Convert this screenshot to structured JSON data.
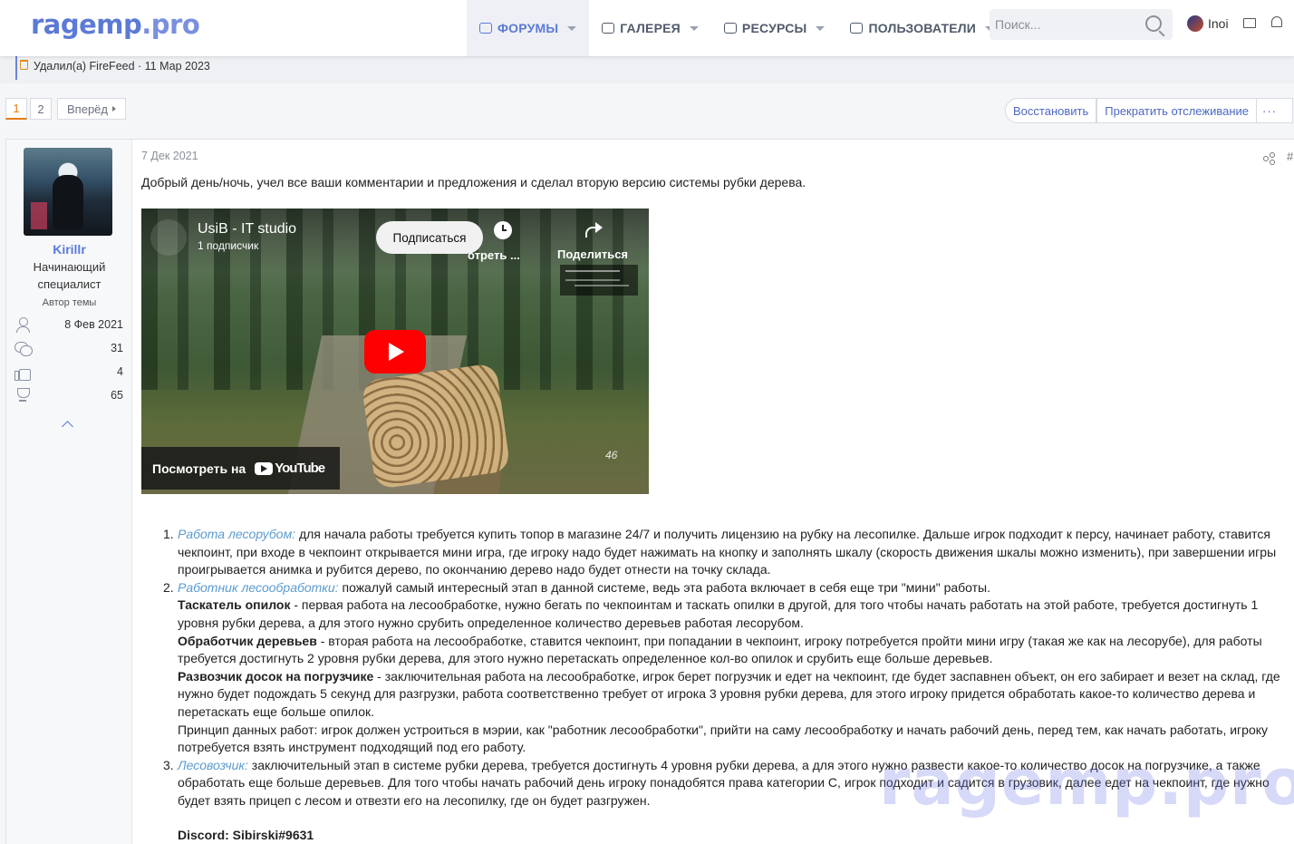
{
  "header": {
    "logo_text": "ragemp",
    "logo_dot": ".pro",
    "nav": [
      {
        "label": "ФОРУМЫ",
        "icon": "forum-icon",
        "active": true
      },
      {
        "label": "ГАЛЕРЕЯ",
        "icon": "gallery-icon"
      },
      {
        "label": "РЕСУРСЫ",
        "icon": "resources-icon"
      },
      {
        "label": "ПОЛЬЗОВАТЕЛИ",
        "icon": "users-icon"
      }
    ],
    "search_placeholder": "Поиск...",
    "username": "Inoi",
    "accent": "#5b7ad6"
  },
  "deleted_notice": "Удалил(а) FireFeed · 11 Мар 2023",
  "pagination": {
    "pages": [
      "1",
      "2"
    ],
    "current": "1",
    "next_label": "Вперёд"
  },
  "thread_actions": {
    "restore": "Восстановить",
    "unwatch": "Прекратить отслеживание",
    "more": "···"
  },
  "post": {
    "author": {
      "name": "Kirillr",
      "title": "Начинающий специалист",
      "badge": "Автор темы",
      "stats": [
        {
          "icon": "person-icon",
          "value": "8 Фев 2021"
        },
        {
          "icon": "chat-icon",
          "value": "31"
        },
        {
          "icon": "thumb-icon",
          "value": "4"
        },
        {
          "icon": "trophy-icon",
          "value": "65"
        }
      ]
    },
    "date": "7 Дек 2021",
    "hash": "#",
    "intro": "Добрый день/ночь, учел все ваши комментарии и предложения и сделал вторую версию системы рубки дерева.",
    "video": {
      "channel": "UsiB - IT studio",
      "subs": "1 подписчик",
      "subscribe": "Подписаться",
      "later": "отреть ...",
      "share": "Поделиться",
      "counter": "46",
      "watch_on": "Посмотреть на",
      "yt_word": "YouTube"
    },
    "list": [
      {
        "num": "1.",
        "title": "Работа лесорубом:",
        "text": " для начала работы требуется купить топор в магазине 24/7 и получить лицензию на рубку на лесопилке. Дальше игрок подходит к персу, начинает работу, ставится чекпоинт, при входе в чекпоинт открывается мини игра, где игроку надо будет нажимать на кнопку и заполнять шкалу (скорость движения шкалы можно изменить), при завершении игры проигрывается анимка и рубится дерево, по окончанию дерево надо будет отнести на точку склада."
      },
      {
        "num": "2.",
        "title": "Работник лесообработки:",
        "text": " пожалуй самый интересный этап в данной системе, ведь эта работа включает в себя еще три \"мини\" работы.",
        "subs": [
          {
            "b": "Таскатель опилок",
            "t": " - первая работа на лесообработке, нужно бегать по чекпоинтам и таскать опилки в другой, для того чтобы начать работать на этой работе, требуется достигнуть 1 уровня рубки дерева, а для этого нужно срубить определенное количество деревьев работая лесорубом."
          },
          {
            "b": "Обработчик деревьев",
            "t": " - вторая работа на лесообработке, ставится чекпоинт, при попадании в чекпоинт, игроку потребуется пройти мини игру (такая же как на лесорубе), для работы требуется достигнуть 2 уровня рубки дерева, для этого нужно перетаскать определенное кол-во опилок и срубить еще больше деревьев."
          },
          {
            "b": "Развозчик досок на погрузчике",
            "t": " - заключительная работа на лесообработке, игрок берет погрузчик и едет на чекпоинт, где будет заспавнен объект, он его забирает и везет на склад, где нужно будет подождать 5 секунд для разгрузки, работа соответственно требует от игрока 3 уровня рубки дерева, для этого игроку придется обработать какое-то количество дерева и перетаскать еще больше опилок."
          }
        ],
        "principle": "Принцип данных работ: игрок должен устроиться в мэрии, как \"работник лесообработки\", прийти на саму лесообработку и начать рабочий день, перед тем, как начать работать, игроку потребуется взять инструмент подходящий под его работу."
      },
      {
        "num": "3.",
        "title": "Лесовозчик:",
        "text": " заключительный этап в системе рубки дерева, требуется достигнуть 4 уровня рубки дерева, а для этого нужно развести какое-то количество досок на погрузчике, а также обработать еще больше деревьев. Для того чтобы начать рабочий день игроку понадобятся права категории C, игрок подходит и садится в грузовик, далее едет на чекпоинт, где нужно будет взять прицеп с лесом и отвезти его на лесопилку, где он будет разгружен."
      }
    ],
    "discord": "Discord: Sibirski#9631"
  },
  "watermark": "ragemp.pro"
}
